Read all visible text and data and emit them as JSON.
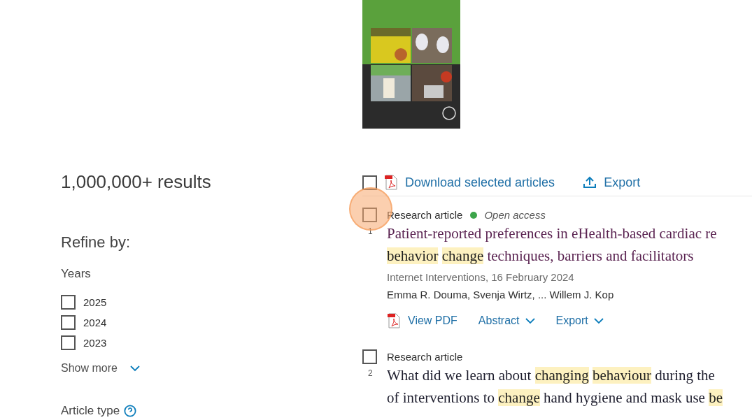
{
  "results_count": "1,000,000+ results",
  "refine": {
    "heading": "Refine by:",
    "years": {
      "label": "Years",
      "options": [
        {
          "label": "2025",
          "checked": false
        },
        {
          "label": "2024",
          "checked": false
        },
        {
          "label": "2023",
          "checked": false
        }
      ],
      "show_more": "Show more"
    },
    "article_type": {
      "label": "Article type"
    }
  },
  "toolbar": {
    "select_all": {
      "checked": false
    },
    "download": "Download selected articles",
    "export": "Export"
  },
  "articles": [
    {
      "number": "1",
      "type": "Research article",
      "open_access": true,
      "access_label": "Open access",
      "checked": false,
      "title_lines": [
        [
          {
            "text": "Patient-reported preferences in eHealth-based cardiac re",
            "highlight": false
          }
        ],
        [
          {
            "text": "behavior",
            "highlight": true
          },
          {
            "text": "change",
            "highlight": true
          },
          {
            "text": "techniques, barriers and facilitators",
            "highlight": false
          }
        ]
      ],
      "source": "Internet Interventions, 16 February 2024",
      "authors": "Emma R. Douma, Svenja Wirtz, ... Willem J. Kop",
      "actions": {
        "pdf": "View PDF",
        "abstract": "Abstract",
        "export": "Export"
      }
    },
    {
      "number": "2",
      "type": "Research article",
      "open_access": false,
      "checked": false,
      "title_lines": [
        [
          {
            "text": "What did we learn about",
            "highlight": false
          },
          {
            "text": "changing",
            "highlight": true
          },
          {
            "text": "behaviour",
            "highlight": true
          },
          {
            "text": "during the",
            "highlight": false
          }
        ],
        [
          {
            "text": "of interventions to",
            "highlight": false
          },
          {
            "text": "change",
            "highlight": true
          },
          {
            "text": "hand hygiene and mask use",
            "highlight": false
          },
          {
            "text": "be",
            "highlight": true
          }
        ]
      ]
    }
  ]
}
